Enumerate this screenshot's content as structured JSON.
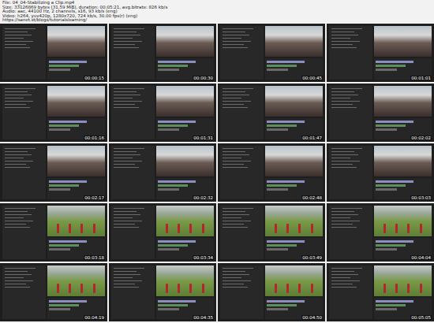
{
  "header": {
    "lines": [
      "File: 04_04-Stabilizing a Clip.mp4",
      "Size: 33126869 bytes (31.59 MiB), duration: 00:05:21, avg.bitrate: 826 kb/s",
      "Audio: aac, 44100 Hz, 2 channels, s16, 93 kb/s (eng)",
      "Video: h264, yuv420p, 1280x720, 724 kb/s, 30.00 fps(r) (eng)",
      "https://sanet.st/blogs/tutorialslearning/"
    ]
  },
  "thumbnails": [
    {
      "time": "00:00:15",
      "kind": "crowd"
    },
    {
      "time": "00:00:30",
      "kind": "crowd"
    },
    {
      "time": "00:00:45",
      "kind": "crowd"
    },
    {
      "time": "00:01:01",
      "kind": "crowd"
    },
    {
      "time": "00:01:16",
      "kind": "crowd"
    },
    {
      "time": "00:01:31",
      "kind": "crowd"
    },
    {
      "time": "00:01:47",
      "kind": "crowd"
    },
    {
      "time": "00:02:02",
      "kind": "crowd"
    },
    {
      "time": "00:02:17",
      "kind": "crowd"
    },
    {
      "time": "00:02:32",
      "kind": "crowd"
    },
    {
      "time": "00:02:48",
      "kind": "crowd"
    },
    {
      "time": "00:03:03",
      "kind": "crowd"
    },
    {
      "time": "00:03:18",
      "kind": "field"
    },
    {
      "time": "00:03:34",
      "kind": "field"
    },
    {
      "time": "00:03:49",
      "kind": "field"
    },
    {
      "time": "00:04:04",
      "kind": "field"
    },
    {
      "time": "00:04:19",
      "kind": "field"
    },
    {
      "time": "00:04:35",
      "kind": "field"
    },
    {
      "time": "00:04:50",
      "kind": "field"
    },
    {
      "time": "00:05:05",
      "kind": "field"
    }
  ]
}
